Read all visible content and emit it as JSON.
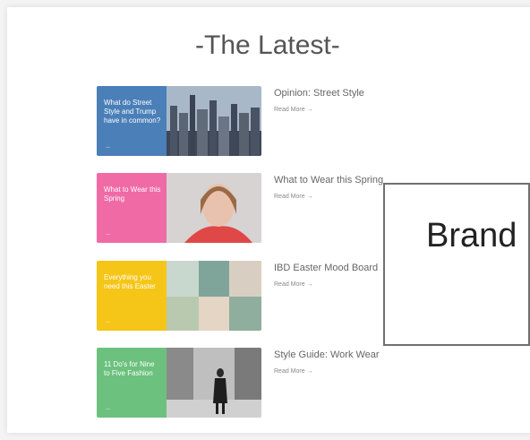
{
  "section": {
    "title": "-The Latest-"
  },
  "posts": [
    {
      "thumb_text": "What do Street Style and Trump have in common?",
      "thumb_color": "#4a7fb8",
      "title": "Opinion: Street Style",
      "read_more": "Read More →"
    },
    {
      "thumb_text": "What to Wear this Spring",
      "thumb_color": "#f06aa6",
      "title": "What to Wear this Spring",
      "read_more": "Read More →"
    },
    {
      "thumb_text": "Everything you need this Easter",
      "thumb_color": "#f5c518",
      "title": "IBD Easter Mood Board",
      "read_more": "Read More →"
    },
    {
      "thumb_text": "11 Do's for Nine to Five Fashion",
      "thumb_color": "#6cc17e",
      "title": "Style Guide: Work Wear",
      "read_more": "Read More →"
    }
  ],
  "overlay": {
    "text": "Brand"
  }
}
